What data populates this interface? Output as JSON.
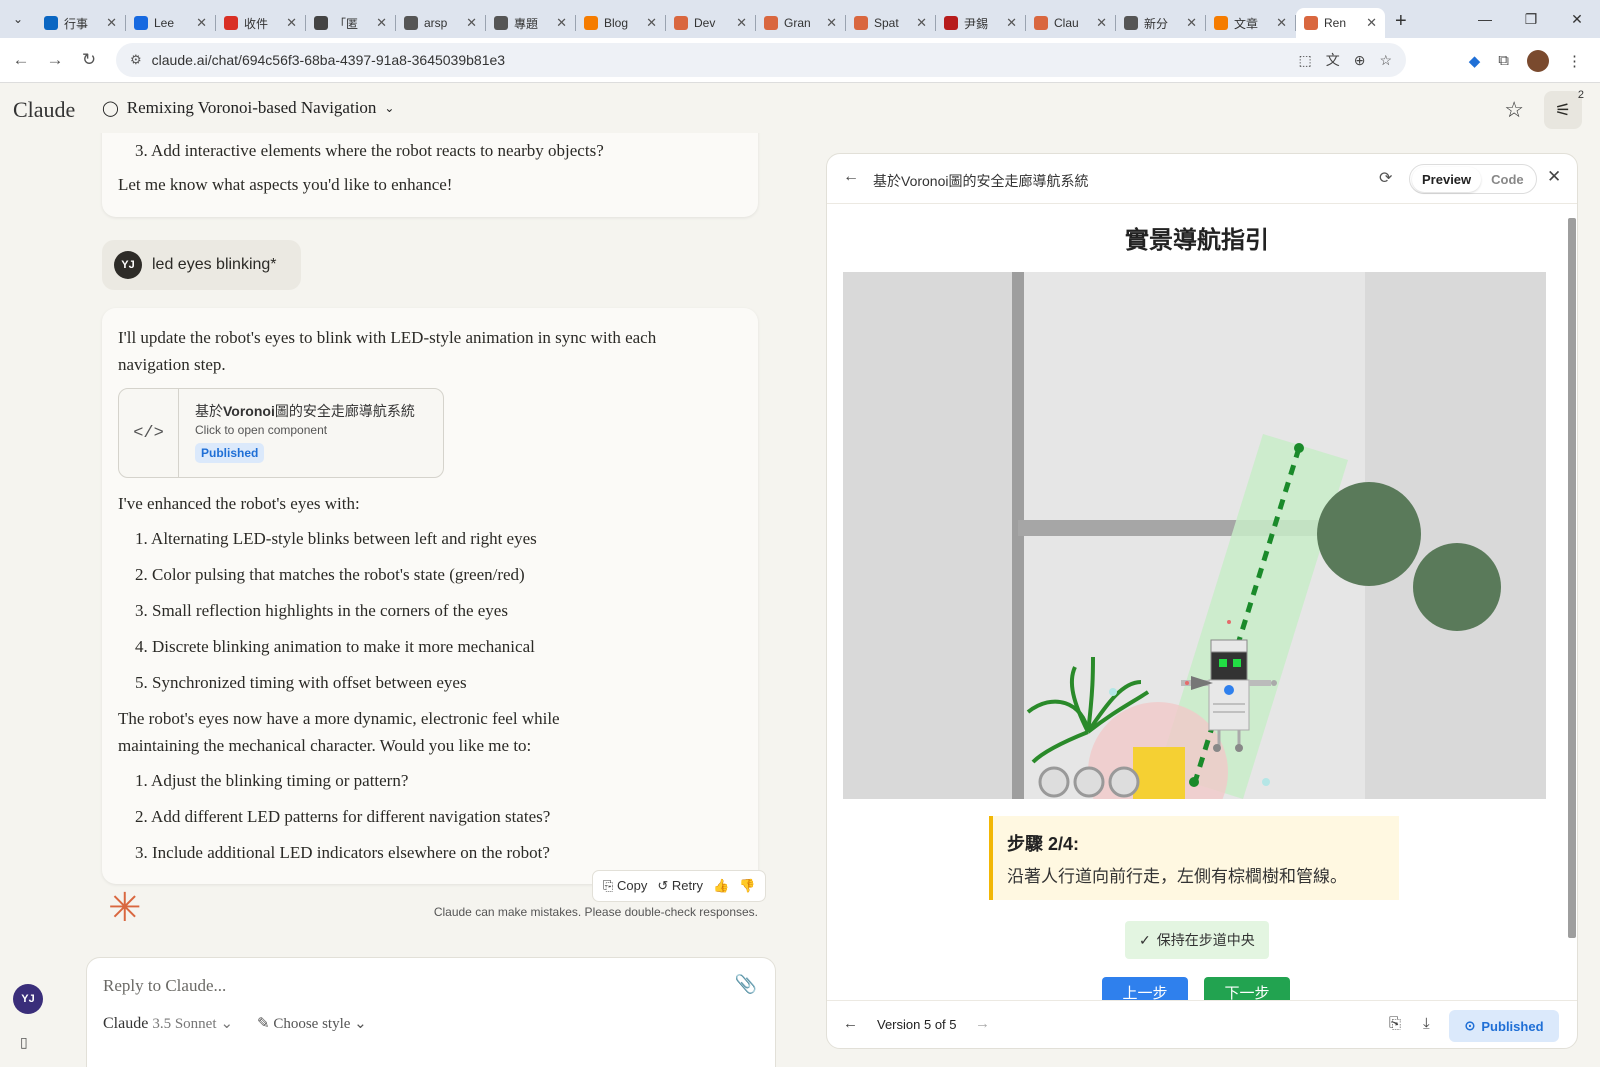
{
  "browser": {
    "tabs": [
      {
        "label": "行事",
        "color": "#0a66c2"
      },
      {
        "label": "Lee",
        "color": "#1769e0"
      },
      {
        "label": "收件",
        "color": "#d93025"
      },
      {
        "label": "「匿",
        "color": "#444444"
      },
      {
        "label": "arsp",
        "color": "#555555"
      },
      {
        "label": "專題",
        "color": "#555555"
      },
      {
        "label": "Blog",
        "color": "#f57c00"
      },
      {
        "label": "Dev",
        "color": "#d9673f"
      },
      {
        "label": "Gran",
        "color": "#d9673f"
      },
      {
        "label": "Spat",
        "color": "#d9673f"
      },
      {
        "label": "尹錫",
        "color": "#b71c1c"
      },
      {
        "label": "Clau",
        "color": "#d9673f"
      },
      {
        "label": "新分",
        "color": "#555555"
      },
      {
        "label": "文章",
        "color": "#f57c00"
      },
      {
        "label": "Ren",
        "color": "#d9673f"
      }
    ],
    "url": "claude.ai/chat/694c56f3-68ba-4397-91a8-3645039b81e3"
  },
  "header": {
    "logo": "Claude",
    "chat_title": "Remixing Voronoi-based Navigation",
    "settings_badge": "2"
  },
  "chat": {
    "prev_list_item": "3. Add interactive elements where the robot reacts to nearby objects?",
    "prev_closing": "Let me know what aspects you'd like to enhance!",
    "user_initials": "YJ",
    "user_message": "led eyes blinking*",
    "reply_intro": "I'll update the robot's eyes to blink with LED-style animation in sync with each navigation step.",
    "artifact": {
      "title_prefix": "基於",
      "title_bold": "Voronoi",
      "title_suffix": "圖的安全走廊導航系統",
      "subtitle": "Click to open component",
      "status": "Published"
    },
    "enhanced_intro": "I've enhanced the robot's eyes with:",
    "enhancements": [
      "1. Alternating LED-style blinks between left and right eyes",
      "2. Color pulsing that matches the robot's state (green/red)",
      "3. Small reflection highlights in the corners of the eyes",
      "4. Discrete blinking animation to make it more mechanical",
      "5. Synchronized timing with offset between eyes"
    ],
    "summary": "The robot's eyes now have a more dynamic, electronic feel while maintaining the mechanical character. Would you like me to:",
    "questions": [
      "1. Adjust the blinking timing or pattern?",
      "2. Add different LED patterns for different navigation states?",
      "3. Include additional LED indicators elsewhere on the robot?"
    ],
    "actions": {
      "copy": "Copy",
      "retry": "Retry"
    },
    "disclaimer": "Claude can make mistakes. Please double-check responses.",
    "composer": {
      "placeholder": "Reply to Claude...",
      "model_name": "Claude",
      "model_version": "3.5 Sonnet",
      "style_label": "Choose style"
    }
  },
  "panel": {
    "title": "基於Voronoi圖的安全走廊導航系統",
    "preview_tab": "Preview",
    "code_tab": "Code",
    "page_heading": "實景導航指引",
    "step_title": "步驟 2/4:",
    "step_desc": "沿著人行道向前行走，左側有棕櫚樹和管線。",
    "hint": "保持在步道中央",
    "prev_btn": "上一步",
    "next_btn": "下一步",
    "version": "Version 5 of 5",
    "published": "Published",
    "scene_colors": {
      "corridor": "#c8ecc8",
      "path": "#1a8a2a",
      "tree": "#5a7a5a",
      "pipe": "#999999",
      "box": "#f5d033",
      "palm": "#2a8a2a"
    }
  }
}
